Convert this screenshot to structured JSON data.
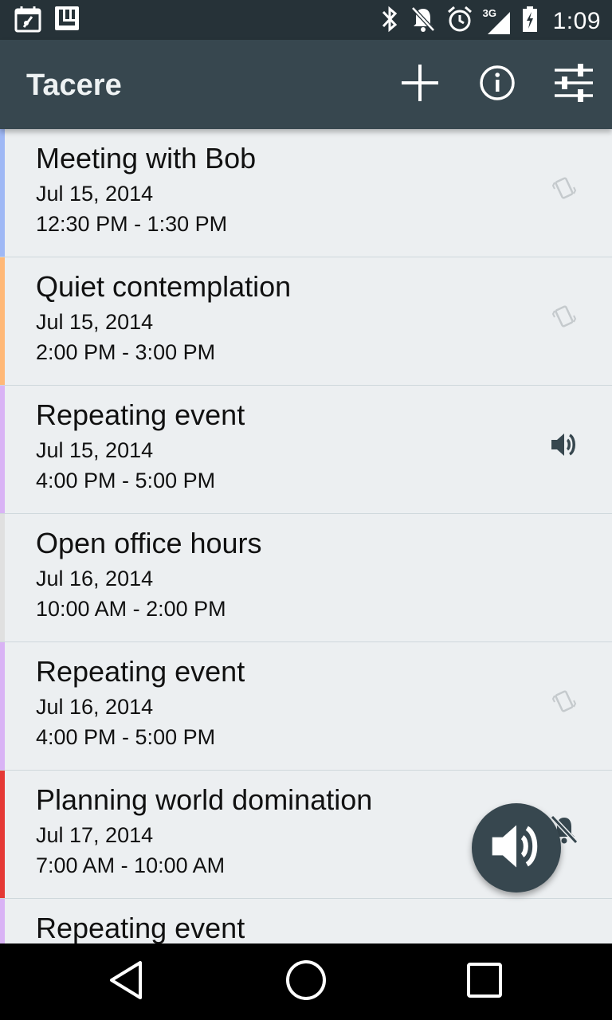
{
  "status_bar": {
    "time": "1:09",
    "network": "3G",
    "left_icons": [
      "calendar-mute-icon",
      "app-l-icon"
    ],
    "right_icons": [
      "bluetooth-icon",
      "notifications-off-icon",
      "alarm-icon",
      "signal-3g-icon",
      "battery-charging-icon"
    ]
  },
  "app_bar": {
    "title": "Tacere",
    "actions": [
      "add-icon",
      "info-icon",
      "settings-sliders-icon"
    ]
  },
  "events": [
    {
      "title": "Meeting with Bob",
      "date": "Jul 15, 2014",
      "time": "12:30 PM - 1:30 PM",
      "color": "#9fb8f5",
      "ringer_icon": "vibrate-icon"
    },
    {
      "title": "Quiet contemplation",
      "date": "Jul 15, 2014",
      "time": "2:00 PM - 3:00 PM",
      "color": "#ffb877",
      "ringer_icon": "vibrate-icon"
    },
    {
      "title": "Repeating event",
      "date": "Jul 15, 2014",
      "time": "4:00 PM - 5:00 PM",
      "color": "#d9b3f5",
      "ringer_icon": "volume-icon"
    },
    {
      "title": "Open office hours",
      "date": "Jul 16, 2014",
      "time": "10:00 AM - 2:00 PM",
      "color": "#e0e0e0",
      "ringer_icon": ""
    },
    {
      "title": "Repeating event",
      "date": "Jul 16, 2014",
      "time": "4:00 PM - 5:00 PM",
      "color": "#d9b3f5",
      "ringer_icon": "vibrate-icon"
    },
    {
      "title": "Planning world domination",
      "date": "Jul 17, 2014",
      "time": "7:00 AM - 10:00 AM",
      "color": "#e53935",
      "ringer_icon": "silent-icon"
    },
    {
      "title": "Repeating event",
      "date": "",
      "time": "",
      "color": "#d9b3f5",
      "ringer_icon": ""
    }
  ],
  "fab": {
    "icon": "volume-icon"
  },
  "nav_bar": {
    "buttons": [
      "back-icon",
      "home-icon",
      "recents-icon"
    ]
  }
}
